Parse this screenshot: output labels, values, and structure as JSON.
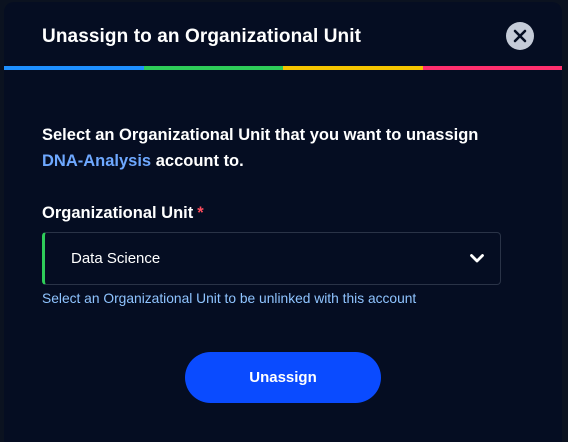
{
  "modal": {
    "title": "Unassign to an Organizational Unit",
    "accent_colors": [
      "#1e8fff",
      "#2ecc59",
      "#f5c400",
      "#ff2f6e"
    ]
  },
  "body": {
    "prompt_start": "Select an Organizational Unit that you want to unassign",
    "account_name": "DNA-Analysis",
    "prompt_end": "account to."
  },
  "field": {
    "label": "Organizational Unit",
    "required_mark": "*",
    "selected_value": "Data Science",
    "helper_text": "Select an Organizational Unit to be unlinked with this account"
  },
  "actions": {
    "submit_label": "Unassign"
  },
  "icons": {
    "close": "close-icon",
    "dropdown": "chevron-down-icon"
  }
}
